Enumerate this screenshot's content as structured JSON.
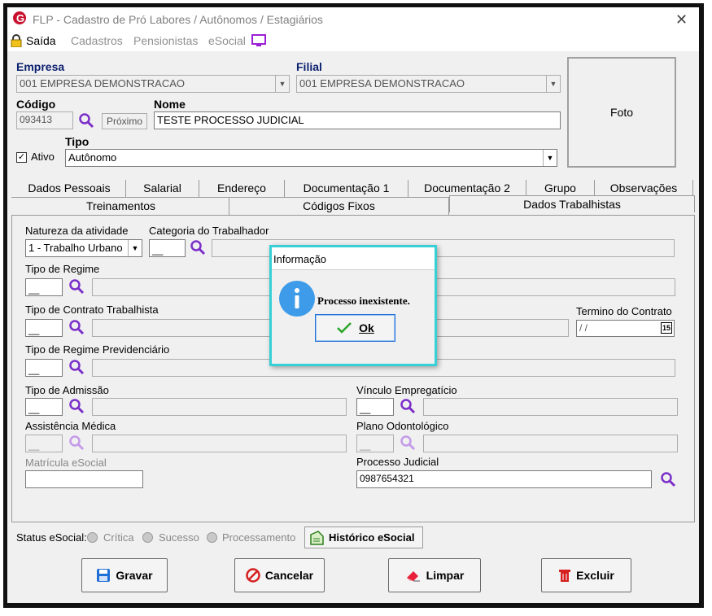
{
  "window": {
    "title": "FLP - Cadastro de Pró Labores / Autônomos / Estagiários"
  },
  "menu": {
    "saida": "Saída",
    "items": [
      "Cadastros",
      "Pensionistas",
      "eSocial"
    ]
  },
  "form": {
    "empresa_label": "Empresa",
    "empresa_value": "001 EMPRESA DEMONSTRACAO",
    "filial_label": "Filial",
    "filial_value": "001 EMPRESA DEMONSTRACAO",
    "codigo_label": "Código",
    "codigo_value": "093413",
    "proximo_label": "Próximo",
    "nome_label": "Nome",
    "nome_value": "TESTE PROCESSO JUDICIAL",
    "tipo_label": "Tipo",
    "tipo_value": "Autônomo",
    "ativo_label": "Ativo",
    "foto_label": "Foto"
  },
  "tabs_row1": [
    "Dados Pessoais",
    "Salarial",
    "Endereço",
    "Documentação 1",
    "Documentação 2",
    "Grupo",
    "Observações"
  ],
  "tabs_row2": [
    "Treinamentos",
    "Códigos Fixos",
    "Dados Trabalhistas"
  ],
  "trab": {
    "natureza_label": "Natureza da atividade",
    "natureza_value": "1 - Trabalho Urbano",
    "categoria_label": "Categoria do Trabalhador",
    "categoria_value": "__",
    "regime_label": "Tipo de Regime",
    "regime_value": "__",
    "contrato_label": "Tipo de Contrato Trabalhista",
    "contrato_value": "__",
    "termino_label": "Termino do Contrato",
    "termino_value": "/ /",
    "cal_label": "15",
    "previd_label": "Tipo de Regime Previdenciário",
    "previd_value": "__",
    "admissao_label": "Tipo de Admissão",
    "admissao_value": "__",
    "vinculo_label": "Vínculo Empregatício",
    "vinculo_value": "__",
    "medica_label": "Assistência Médica",
    "medica_value": "__",
    "odonto_label": "Plano Odontológico",
    "odonto_value": "__",
    "matricula_label": "Matrícula eSocial",
    "processo_label": "Processo Judicial",
    "processo_value": "0987654321"
  },
  "dialog": {
    "title": "Informação",
    "message": "Processo inexistente.",
    "ok_label": "Ok"
  },
  "status": {
    "label": "Status eSocial:",
    "critica": "Crítica",
    "sucesso": "Sucesso",
    "processamento": "Processamento",
    "historico": "Histórico eSocial"
  },
  "buttons": {
    "gravar": "Gravar",
    "cancelar": "Cancelar",
    "limpar": "Limpar",
    "excluir": "Excluir"
  },
  "colors": {
    "accent_dialog": "#36d0d6",
    "label_navy": "#0a1f6e",
    "magnifier": "#7b2fc9"
  }
}
